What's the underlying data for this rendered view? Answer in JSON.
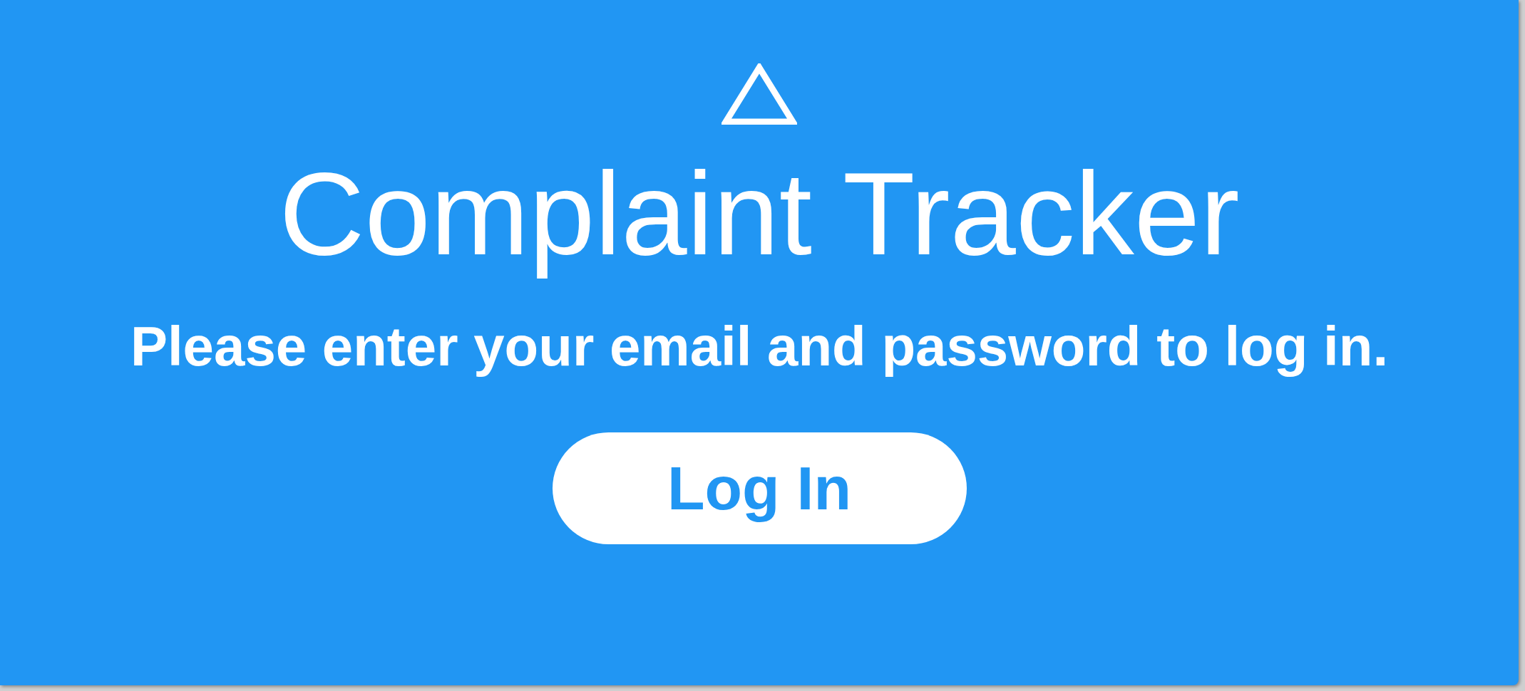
{
  "app": {
    "title": "Complaint Tracker",
    "message": "Please enter your email and password to log in.",
    "login_button": "Log In"
  }
}
